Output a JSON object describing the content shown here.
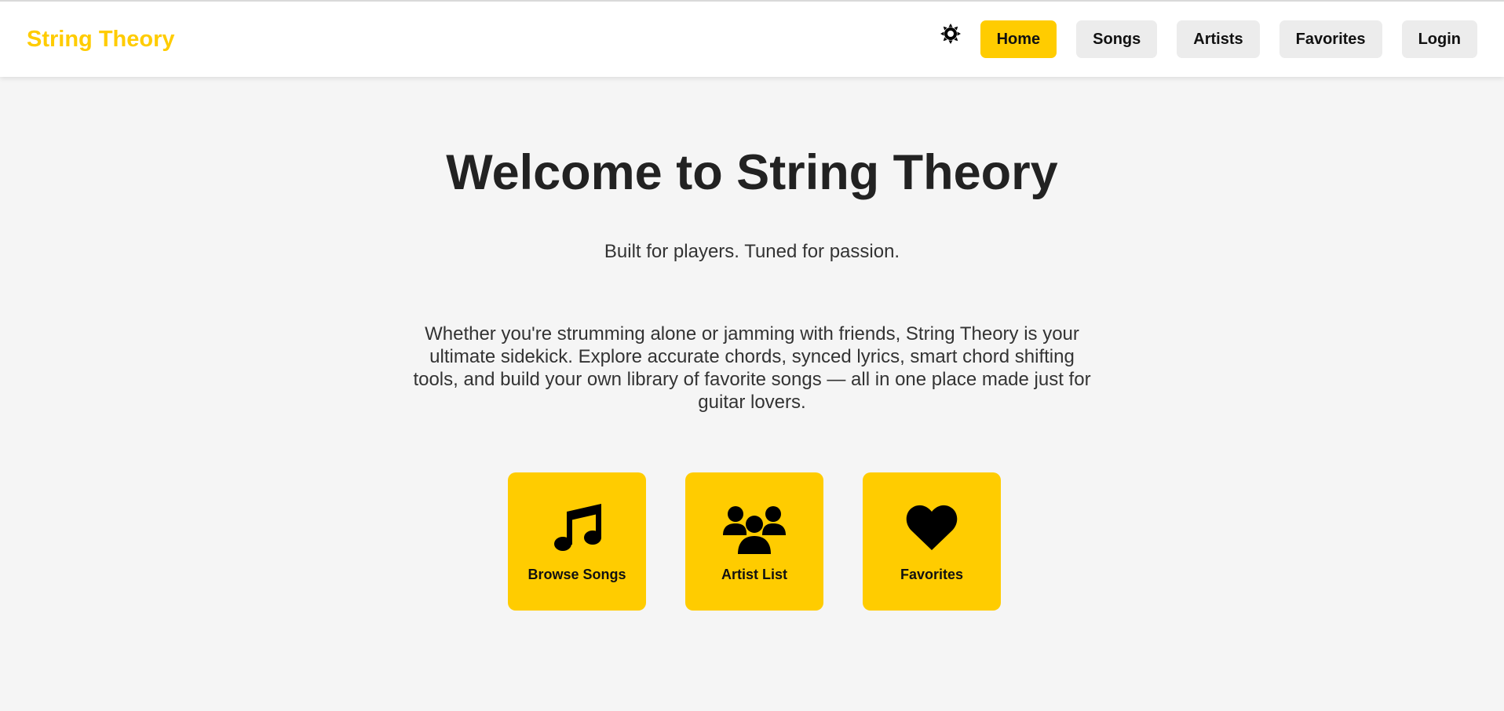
{
  "header": {
    "brand": "String Theory",
    "theme_toggle_icon": "sun-icon",
    "nav": [
      {
        "label": "Home",
        "active": true
      },
      {
        "label": "Songs",
        "active": false
      },
      {
        "label": "Artists",
        "active": false
      },
      {
        "label": "Favorites",
        "active": false
      },
      {
        "label": "Login",
        "active": false
      }
    ]
  },
  "hero": {
    "title": "Welcome to String Theory",
    "subtitle": "Built for players. Tuned for passion.",
    "description": "Whether you're strumming alone or jamming with friends, String Theory is your ultimate sidekick. Explore accurate chords, synced lyrics, smart chord shifting tools, and build your own library of favorite songs — all in one place made just for guitar lovers."
  },
  "tiles": [
    {
      "label": "Browse Songs",
      "icon": "music-note-icon"
    },
    {
      "label": "Artist List",
      "icon": "users-icon"
    },
    {
      "label": "Favorites",
      "icon": "heart-icon"
    }
  ],
  "colors": {
    "accent": "#ffcc00",
    "background": "#f5f5f5",
    "nav_button": "#ececec",
    "text_dark": "#222222"
  }
}
